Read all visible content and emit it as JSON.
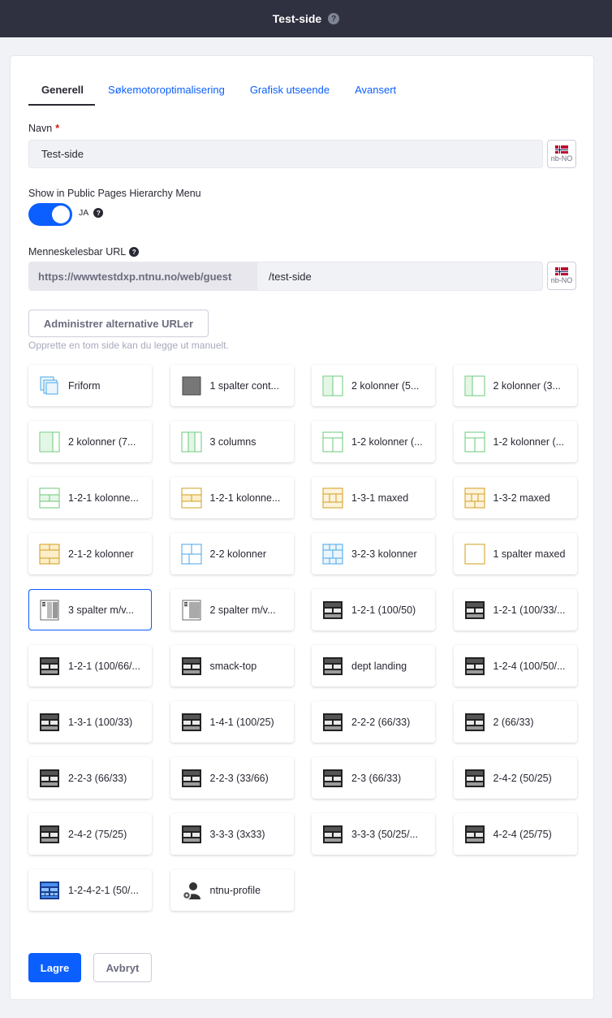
{
  "header": {
    "title": "Test-side",
    "help_icon": "?"
  },
  "tabs": [
    {
      "label": "Generell",
      "active": true
    },
    {
      "label": "Søkemotoroptimalisering",
      "active": false
    },
    {
      "label": "Grafisk utseende",
      "active": false
    },
    {
      "label": "Avansert",
      "active": false
    }
  ],
  "name_field": {
    "label": "Navn",
    "required_mark": "*",
    "value": "Test-side",
    "locale": "nb-NO"
  },
  "hierarchy_toggle": {
    "label": "Show in Public Pages Hierarchy Menu",
    "state_text": "JA",
    "checked": true
  },
  "url_field": {
    "label": "Menneskelesbar URL",
    "prefix": "https://wwwtestdxp.ntnu.no/web/guest",
    "value": "/test-side",
    "locale": "nb-NO"
  },
  "alt_urls_button": "Administrer alternative URLer",
  "template_hint": "Opprette en tom side kan du legge ut manuelt.",
  "templates": [
    {
      "label": "Friform",
      "icon": "freeform-icon"
    },
    {
      "label": "1 spalter cont...",
      "icon": "one-column-icon"
    },
    {
      "label": "2 kolonner (5...",
      "icon": "two-columns-icon"
    },
    {
      "label": "2 kolonner (3...",
      "icon": "two-columns-icon"
    },
    {
      "label": "2 kolonner (7...",
      "icon": "two-columns-icon"
    },
    {
      "label": "3 columns",
      "icon": "three-columns-icon"
    },
    {
      "label": "1-2 kolonner (...",
      "icon": "one-two-columns-icon"
    },
    {
      "label": "1-2 kolonner (...",
      "icon": "one-two-columns-icon"
    },
    {
      "label": "1-2-1 kolonne...",
      "icon": "one-two-one-icon"
    },
    {
      "label": "1-2-1 kolonne...",
      "icon": "one-two-one-yellow-icon"
    },
    {
      "label": "1-3-1 maxed",
      "icon": "one-three-one-icon"
    },
    {
      "label": "1-3-2 maxed",
      "icon": "one-three-two-icon"
    },
    {
      "label": "2-1-2 kolonner",
      "icon": "two-one-two-icon"
    },
    {
      "label": "2-2 kolonner",
      "icon": "two-two-icon"
    },
    {
      "label": "3-2-3 kolonner",
      "icon": "three-two-three-icon"
    },
    {
      "label": "1 spalter maxed",
      "icon": "one-column-maxed-icon"
    },
    {
      "label": "3 spalter m/v...",
      "icon": "three-col-side-icon"
    },
    {
      "label": "2 spalter m/v...",
      "icon": "two-col-side-icon"
    },
    {
      "label": "1-2-1 (100/50)",
      "icon": "dark-layout-icon"
    },
    {
      "label": "1-2-1 (100/33/...",
      "icon": "dark-layout-icon"
    },
    {
      "label": "1-2-1 (100/66/...",
      "icon": "dark-layout-icon"
    },
    {
      "label": "smack-top",
      "icon": "dark-layout-icon"
    },
    {
      "label": "dept landing",
      "icon": "dark-layout-icon"
    },
    {
      "label": "1-2-4 (100/50/...",
      "icon": "dark-layout-icon"
    },
    {
      "label": "1-3-1 (100/33)",
      "icon": "dark-layout-icon"
    },
    {
      "label": "1-4-1 (100/25)",
      "icon": "dark-layout-icon"
    },
    {
      "label": "2-2-2 (66/33)",
      "icon": "dark-layout-icon"
    },
    {
      "label": "2 (66/33)",
      "icon": "dark-layout-icon"
    },
    {
      "label": "2-2-3 (66/33)",
      "icon": "dark-layout-icon"
    },
    {
      "label": "2-2-3 (33/66)",
      "icon": "dark-layout-icon"
    },
    {
      "label": "2-3 (66/33)",
      "icon": "dark-layout-icon"
    },
    {
      "label": "2-4-2 (50/25)",
      "icon": "dark-layout-icon"
    },
    {
      "label": "2-4-2 (75/25)",
      "icon": "dark-layout-icon"
    },
    {
      "label": "3-3-3 (3x33)",
      "icon": "dark-layout-icon"
    },
    {
      "label": "3-3-3 (50/25/...",
      "icon": "dark-layout-icon"
    },
    {
      "label": "4-2-4 (25/75)",
      "icon": "dark-layout-icon"
    },
    {
      "label": "1-2-4-2-1 (50/...",
      "icon": "blue-layout-icon"
    },
    {
      "label": "ntnu-profile",
      "icon": "profile-gear-icon"
    }
  ],
  "selected_template_index": 16,
  "actions": {
    "save": "Lagre",
    "cancel": "Avbryt"
  },
  "colors": {
    "primary": "#0b5fff",
    "header_bg": "#2f3140",
    "green_layout": "#6bc87a",
    "yellow_layout": "#d39c1c",
    "blue_layout": "#4aa6e8"
  }
}
